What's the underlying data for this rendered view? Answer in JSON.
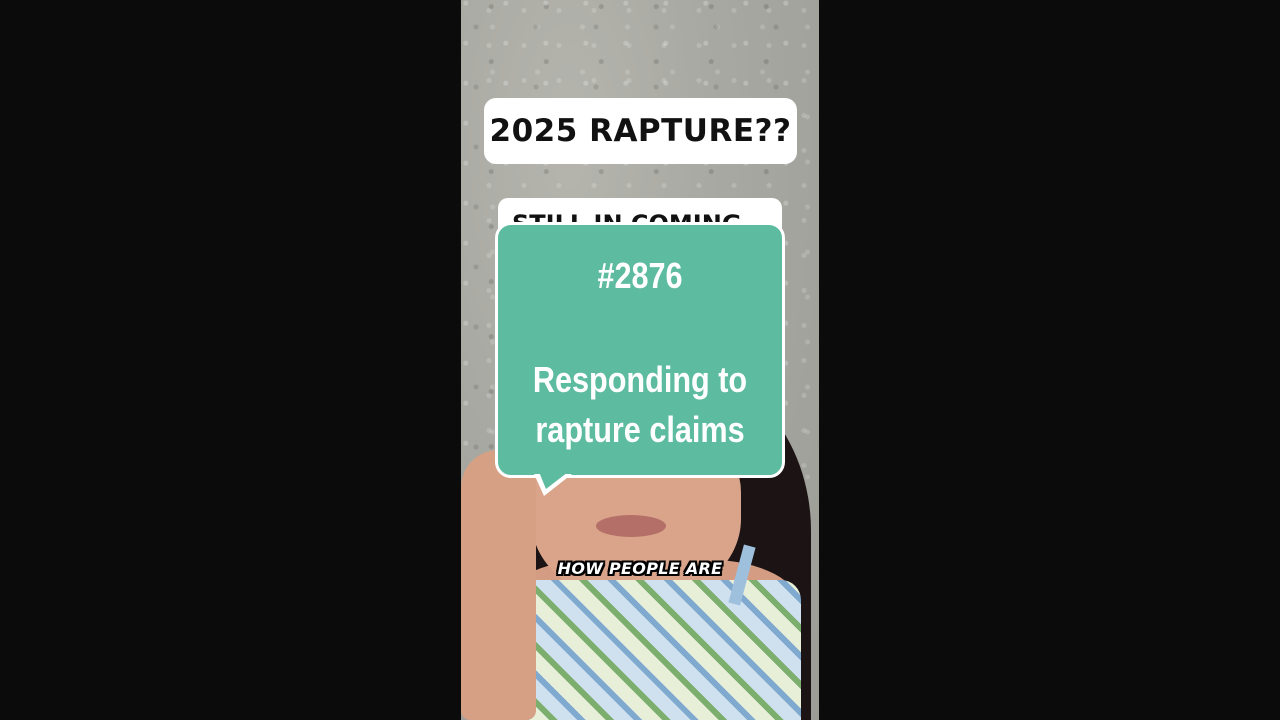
{
  "video": {
    "title_banner": "2025 RAPTURE??",
    "second_banner": "STILL IN COMING",
    "bubble": {
      "number": "#2876",
      "caption_line1": "Responding to",
      "caption_line2": "rapture claims"
    },
    "subtitle": "HOW PEOPLE ARE"
  },
  "colors": {
    "bubble": "#5dbba0",
    "background": "#0b0b0b",
    "banner": "#ffffff"
  }
}
